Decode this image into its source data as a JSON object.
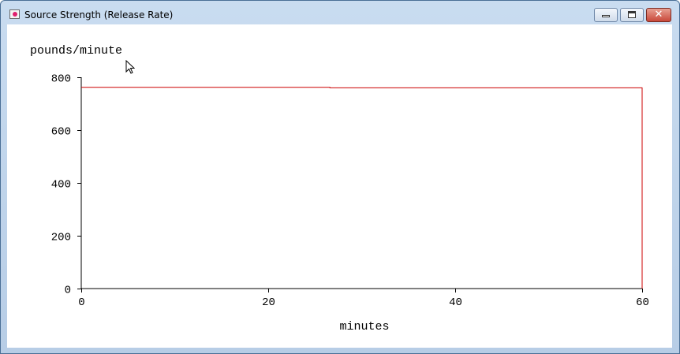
{
  "window": {
    "title": "Source Strength (Release Rate)",
    "icon": "app-window-icon",
    "controls": {
      "minimize_icon": "minimize-icon",
      "maximize_icon": "maximize-icon",
      "close_icon": "close-icon"
    }
  },
  "chart_data": {
    "type": "line",
    "title": "",
    "xlabel": "minutes",
    "ylabel": "pounds/minute",
    "xlim": [
      0,
      60
    ],
    "ylim": [
      0,
      800
    ],
    "x_ticks": [
      0,
      20,
      40,
      60
    ],
    "y_ticks": [
      0,
      200,
      400,
      600,
      800
    ],
    "x_tick_labels": [
      "0",
      "20",
      "40",
      "60"
    ],
    "y_tick_labels": [
      "0",
      "200",
      "400",
      "600",
      "800"
    ],
    "grid": false,
    "legend": "none",
    "series": [
      {
        "color": "#cc0000",
        "points": [
          [
            0,
            762
          ],
          [
            26.6,
            762
          ],
          [
            26.6,
            760
          ],
          [
            60,
            760
          ],
          [
            60,
            0
          ]
        ]
      }
    ]
  }
}
